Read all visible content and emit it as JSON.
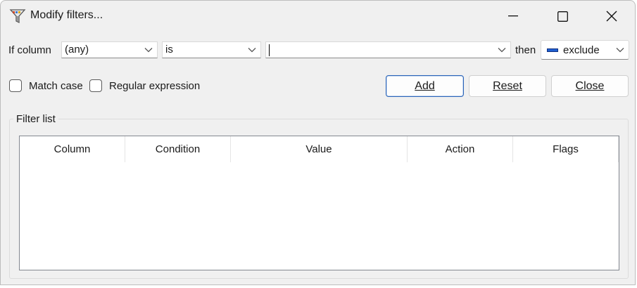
{
  "window": {
    "title": "Modify filters..."
  },
  "filter": {
    "if_column_label": "If column",
    "column_value": "(any)",
    "condition_value": "is",
    "value_input": "",
    "then_label": "then",
    "action_value": "exclude"
  },
  "options": {
    "match_case_label": "Match case",
    "regex_label": "Regular expression"
  },
  "buttons": {
    "add": "Add",
    "reset": "Reset",
    "close": "Close"
  },
  "filter_list": {
    "label": "Filter list",
    "columns": [
      "Column",
      "Condition",
      "Value",
      "Action",
      "Flags"
    ]
  },
  "colors": {
    "accent": "#2a64b8",
    "exclude_swatch": "#1f5fd1"
  }
}
